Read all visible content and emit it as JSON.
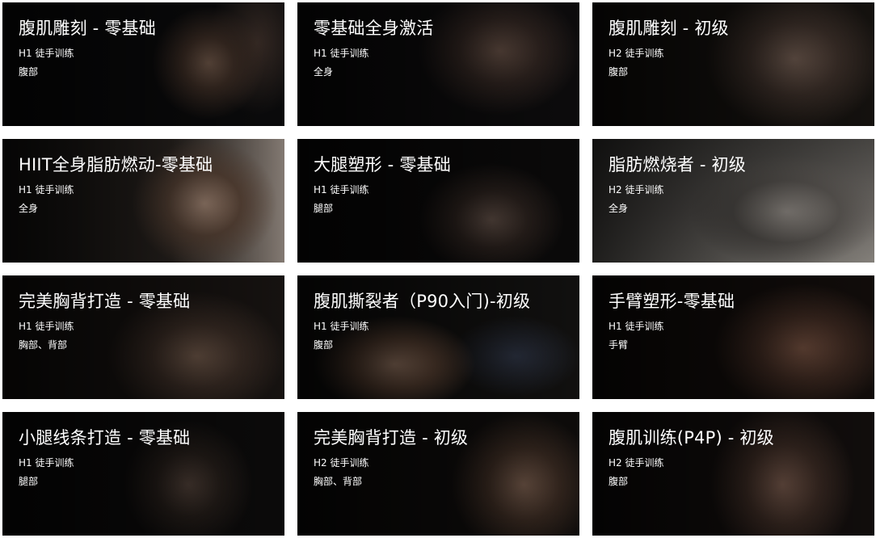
{
  "courses": [
    {
      "title": "腹肌雕刻 - 零基础",
      "level": "H1 徒手训练",
      "part": "腹部"
    },
    {
      "title": "零基础全身激活",
      "level": "H1 徒手训练",
      "part": "全身"
    },
    {
      "title": "腹肌雕刻 - 初级",
      "level": "H2 徒手训练",
      "part": "腹部"
    },
    {
      "title": "HIIT全身脂肪燃动-零基础",
      "level": "H1 徒手训练",
      "part": "全身"
    },
    {
      "title": "大腿塑形 - 零基础",
      "level": "H1 徒手训练",
      "part": "腿部"
    },
    {
      "title": "脂肪燃烧者 - 初级",
      "level": "H2 徒手训练",
      "part": "全身"
    },
    {
      "title": "完美胸背打造 - 零基础",
      "level": "H1 徒手训练",
      "part": "胸部、背部"
    },
    {
      "title": "腹肌撕裂者（P90入门)-初级",
      "level": "H1 徒手训练",
      "part": "腹部"
    },
    {
      "title": "手臂塑形-零基础",
      "level": "H1 徒手训练",
      "part": "手臂"
    },
    {
      "title": "小腿线条打造 - 零基础",
      "level": "H1 徒手训练",
      "part": "腿部"
    },
    {
      "title": "完美胸背打造 - 初级",
      "level": "H2 徒手训练",
      "part": "胸部、背部"
    },
    {
      "title": "腹肌训练(P4P) - 初级",
      "level": "H2 徒手训练",
      "part": "腹部"
    }
  ]
}
